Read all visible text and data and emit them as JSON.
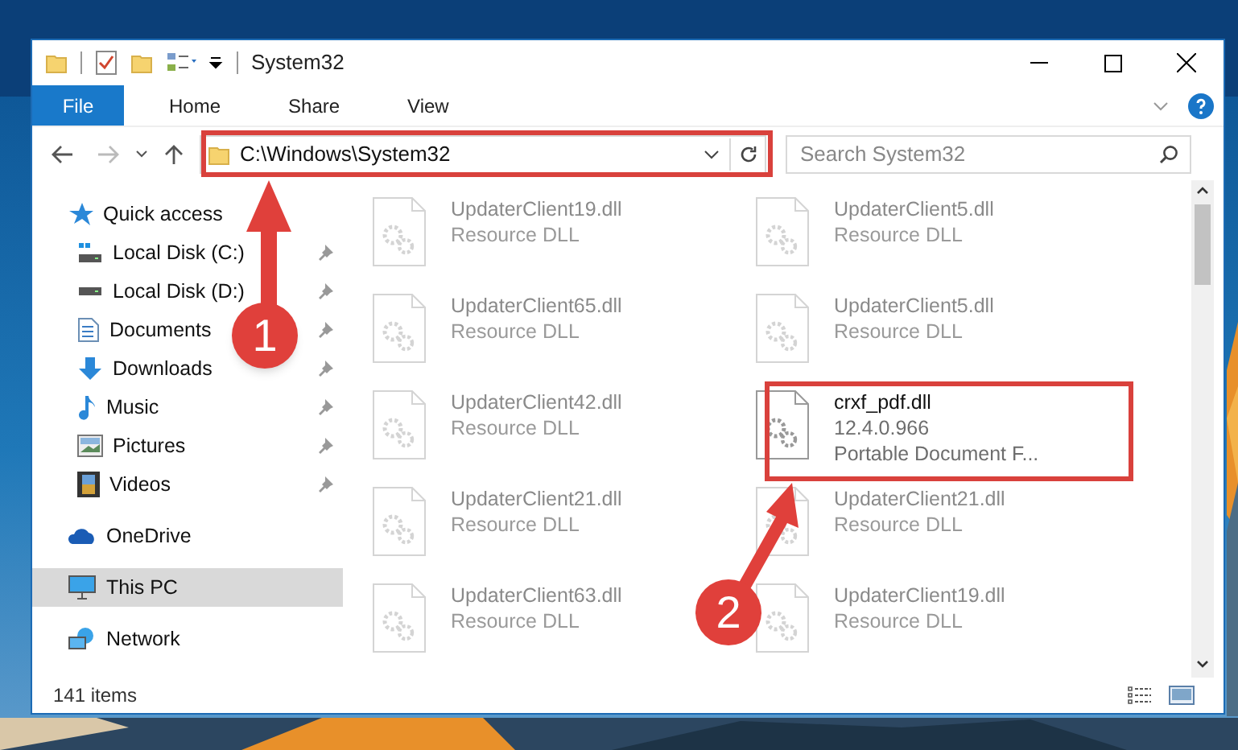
{
  "window": {
    "title": "System32"
  },
  "ribbon_tabs": [
    {
      "label": "File",
      "kind": "file"
    },
    {
      "label": "Home",
      "kind": "tab"
    },
    {
      "label": "Share",
      "kind": "tab"
    },
    {
      "label": "View",
      "kind": "tab"
    }
  ],
  "address": {
    "path": "C:\\Windows\\System32"
  },
  "search": {
    "placeholder": "Search System32"
  },
  "nav": [
    {
      "label": "Quick access",
      "selected": false,
      "children": [
        {
          "label": "Local Disk (C:)",
          "pinned": true,
          "selected": false
        },
        {
          "label": "Local Disk (D:)",
          "pinned": true,
          "selected": false
        },
        {
          "label": "Documents",
          "pinned": true,
          "selected": false
        },
        {
          "label": "Downloads",
          "pinned": true,
          "selected": false
        },
        {
          "label": "Music",
          "pinned": true,
          "selected": false
        },
        {
          "label": "Pictures",
          "pinned": true,
          "selected": false
        },
        {
          "label": "Videos",
          "pinned": true,
          "selected": false
        }
      ]
    },
    {
      "label": "OneDrive",
      "selected": false
    },
    {
      "label": "This PC",
      "selected": true
    },
    {
      "label": "Network",
      "selected": false
    }
  ],
  "files": [
    {
      "name": "UpdaterClient19.dll",
      "lines": [
        "Resource DLL"
      ],
      "faded": true
    },
    {
      "name": "UpdaterClient5.dll",
      "lines": [
        "Resource DLL"
      ],
      "faded": true
    },
    {
      "name": "UpdaterClient65.dll",
      "lines": [
        "Resource DLL"
      ],
      "faded": true
    },
    {
      "name": "UpdaterClient5.dll",
      "lines": [
        "Resource DLL"
      ],
      "faded": true
    },
    {
      "name": "UpdaterClient42.dll",
      "lines": [
        "Resource DLL"
      ],
      "faded": true
    },
    {
      "name": "crxf_pdf.dll",
      "lines": [
        "12.4.0.966",
        "Portable Document F..."
      ],
      "faded": false
    },
    {
      "name": "UpdaterClient21.dll",
      "lines": [
        "Resource DLL"
      ],
      "faded": true
    },
    {
      "name": "UpdaterClient21.dll",
      "lines": [
        "Resource DLL"
      ],
      "faded": true
    },
    {
      "name": "UpdaterClient63.dll",
      "lines": [
        "Resource DLL"
      ],
      "faded": true
    },
    {
      "name": "UpdaterClient19.dll",
      "lines": [
        "Resource DLL"
      ],
      "faded": true
    }
  ],
  "status_bar": {
    "item_count": "141 items"
  },
  "annotations": [
    {
      "label": "1"
    },
    {
      "label": "2"
    }
  ]
}
